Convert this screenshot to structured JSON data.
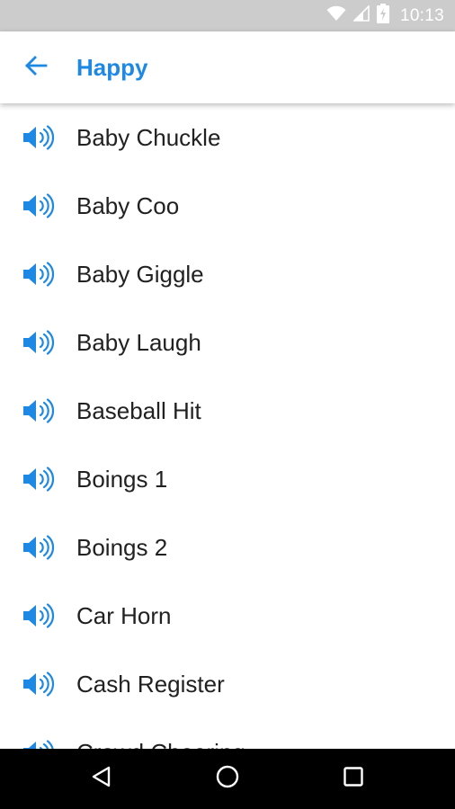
{
  "status_bar": {
    "time": "10:13",
    "icons": [
      "wifi-icon",
      "cell-signal-icon",
      "battery-charging-icon"
    ]
  },
  "app_bar": {
    "back_icon": "arrow-left-icon",
    "title": "Happy"
  },
  "sounds": {
    "icon": "speaker-volume-icon",
    "items": [
      {
        "label": "Baby Chuckle"
      },
      {
        "label": "Baby Coo"
      },
      {
        "label": "Baby Giggle"
      },
      {
        "label": "Baby Laugh"
      },
      {
        "label": "Baseball Hit"
      },
      {
        "label": "Boings 1"
      },
      {
        "label": "Boings 2"
      },
      {
        "label": "Car Horn"
      },
      {
        "label": "Cash Register"
      },
      {
        "label": "Crowd Cheering"
      }
    ]
  },
  "nav_bar": {
    "icons": [
      "back-triangle-icon",
      "home-circle-icon",
      "recents-square-icon"
    ]
  },
  "colors": {
    "accent": "#1e88e5",
    "status_bar": "#cccccc",
    "nav_bar": "#000000",
    "text": "#212121"
  }
}
